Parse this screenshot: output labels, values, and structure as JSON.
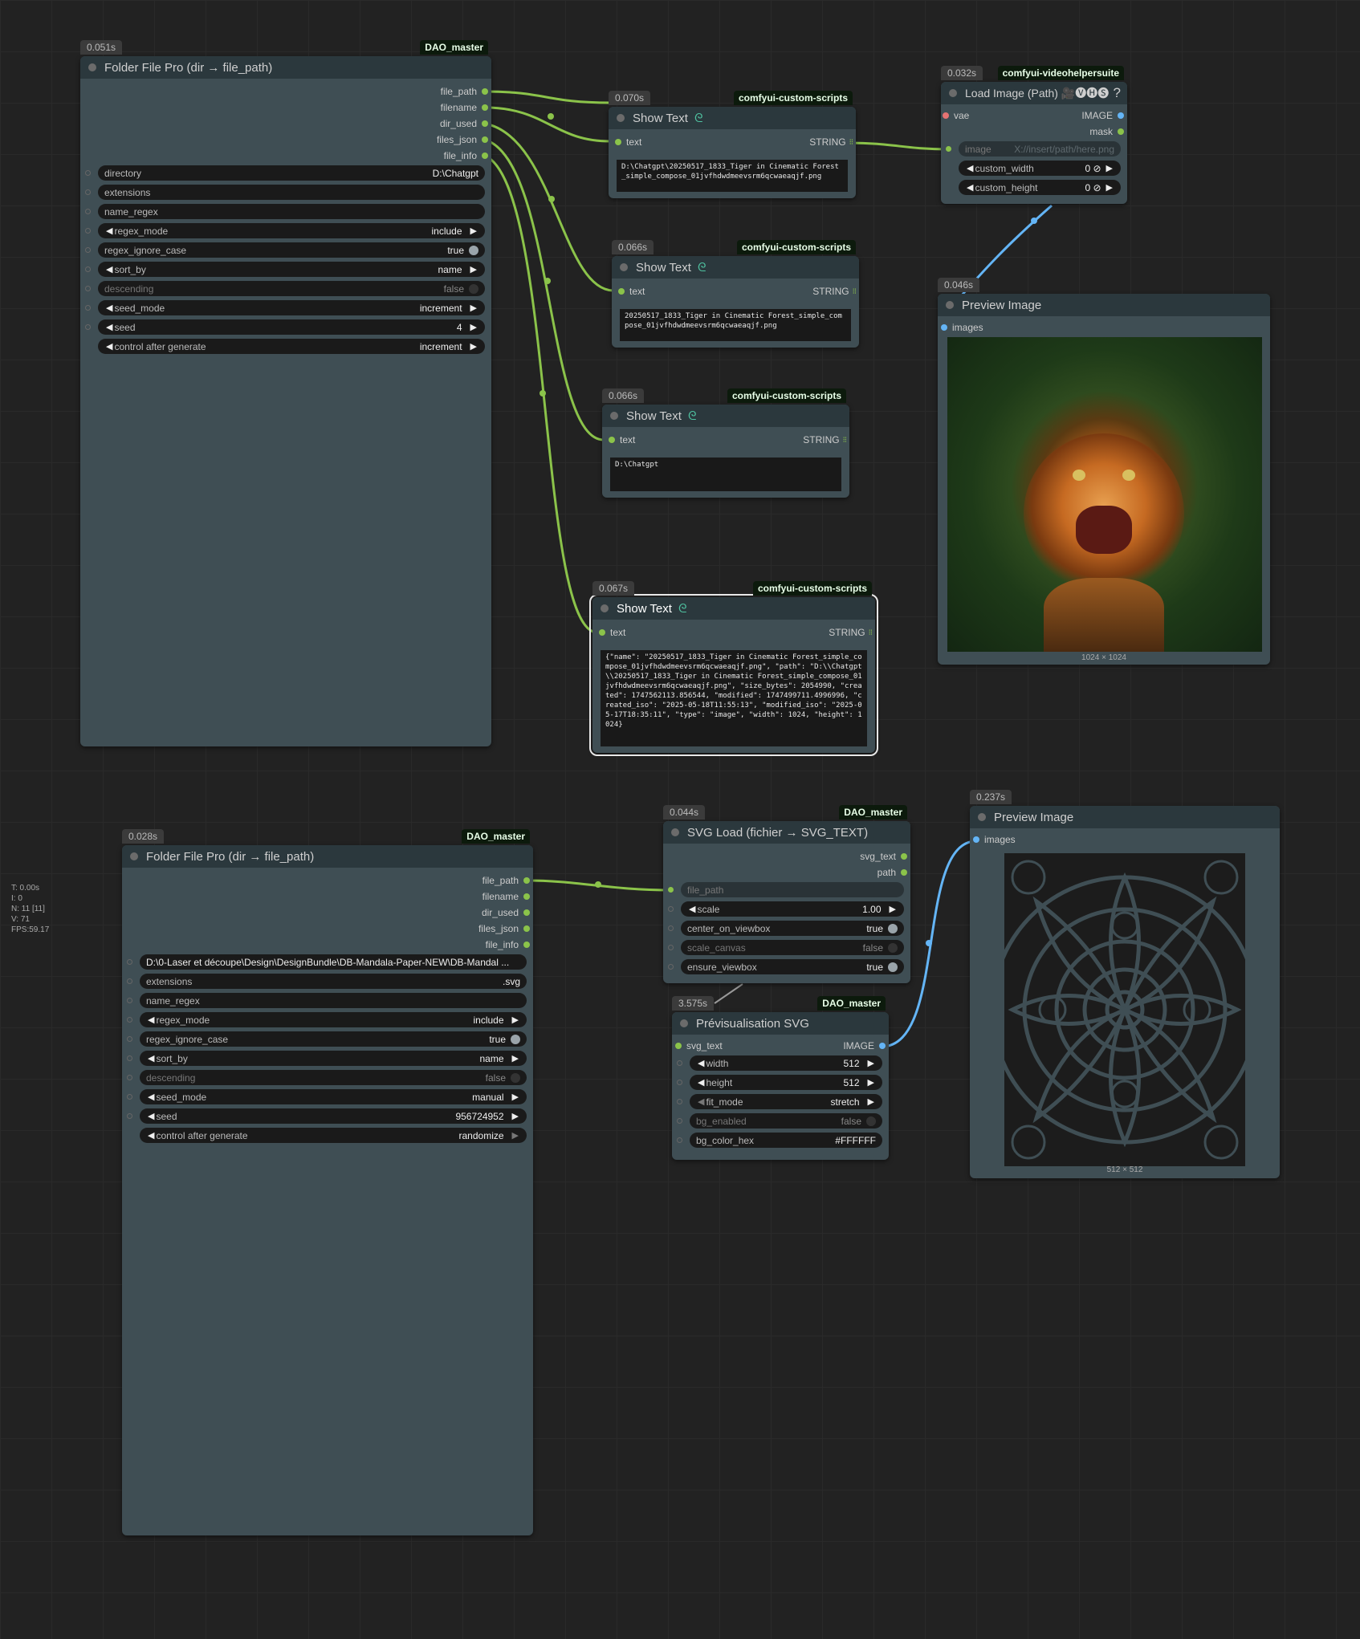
{
  "stats": [
    "T: 0.00s",
    "I: 0",
    "N: 11 [11]",
    "V: 71",
    "FPS:59.17"
  ],
  "folder1": {
    "timing": "0.051s",
    "source": "DAO_master",
    "title": "Folder File Pro (dir → file_path)",
    "outputs": [
      "file_path",
      "filename",
      "dir_used",
      "files_json",
      "file_info"
    ],
    "widgets": [
      {
        "label": "directory",
        "value": "D:\\Chatgpt"
      },
      {
        "label": "extensions",
        "value": ""
      },
      {
        "label": "name_regex",
        "value": ""
      },
      {
        "label": "regex_mode",
        "value": "include"
      },
      {
        "label": "regex_ignore_case",
        "value": "true"
      },
      {
        "label": "sort_by",
        "value": "name"
      },
      {
        "label": "descending",
        "value": "false"
      },
      {
        "label": "seed_mode",
        "value": "increment"
      },
      {
        "label": "seed",
        "value": "4"
      },
      {
        "label": "control after generate",
        "value": "increment"
      }
    ]
  },
  "show1": {
    "timing": "0.070s",
    "source": "comfyui-custom-scripts",
    "title": "Show Text",
    "in": "text",
    "out": "STRING",
    "text": "D:\\Chatgpt\\20250517_1833_Tiger in Cinematic Forest_simple_compose_01jvfhdwdmeevsrm6qcwaeaqjf.png"
  },
  "show2": {
    "timing": "0.066s",
    "source": "comfyui-custom-scripts",
    "title": "Show Text",
    "in": "text",
    "out": "STRING",
    "text": "20250517_1833_Tiger in Cinematic Forest_simple_compose_01jvfhdwdmeevsrm6qcwaeaqjf.png"
  },
  "show3": {
    "timing": "0.066s",
    "source": "comfyui-custom-scripts",
    "title": "Show Text",
    "in": "text",
    "out": "STRING",
    "text": "D:\\Chatgpt"
  },
  "show4": {
    "timing": "0.067s",
    "source": "comfyui-custom-scripts",
    "title": "Show Text",
    "in": "text",
    "out": "STRING",
    "text": "{\"name\": \"20250517_1833_Tiger in Cinematic Forest_simple_compose_01jvfhdwdmeevsrm6qcwaeaqjf.png\", \"path\": \"D:\\\\Chatgpt\\\\20250517_1833_Tiger in Cinematic Forest_simple_compose_01jvfhdwdmeevsrm6qcwaeaqjf.png\", \"size_bytes\": 2054990, \"created\": 1747562113.856544, \"modified\": 1747499711.4996996, \"created_iso\": \"2025-05-18T11:55:13\", \"modified_iso\": \"2025-05-17T18:35:11\", \"type\": \"image\", \"width\": 1024, \"height\": 1024}"
  },
  "loadimg": {
    "timing": "0.032s",
    "source": "comfyui-videohelpersuite",
    "title": "Load Image (Path) 🎥🅥🅗🅢",
    "help": "?",
    "in": "vae",
    "outs": [
      "IMAGE",
      "mask"
    ],
    "image_label": "image",
    "image_placeholder": "X://insert/path/here.png",
    "widgets": [
      {
        "label": "custom_width",
        "value": "0 ⊘"
      },
      {
        "label": "custom_height",
        "value": "0 ⊘"
      }
    ]
  },
  "preview1": {
    "timing": "0.046s",
    "title": "Preview Image",
    "in": "images",
    "caption": "1024 × 1024"
  },
  "folder2": {
    "timing": "0.028s",
    "source": "DAO_master",
    "title": "Folder File Pro (dir → file_path)",
    "outputs": [
      "file_path",
      "filename",
      "dir_used",
      "files_json",
      "file_info"
    ],
    "widgets": [
      {
        "label": "",
        "value": "D:\\0-Laser et découpe\\Design\\DesignBundle\\DB-Mandala-Paper-NEW\\DB-Mandal ..."
      },
      {
        "label": "extensions",
        "value": ".svg"
      },
      {
        "label": "name_regex",
        "value": ""
      },
      {
        "label": "regex_mode",
        "value": "include"
      },
      {
        "label": "regex_ignore_case",
        "value": "true"
      },
      {
        "label": "sort_by",
        "value": "name"
      },
      {
        "label": "descending",
        "value": "false"
      },
      {
        "label": "seed_mode",
        "value": "manual"
      },
      {
        "label": "seed",
        "value": "956724952"
      },
      {
        "label": "control after generate",
        "value": "randomize"
      }
    ]
  },
  "svgload": {
    "timing": "0.044s",
    "source": "DAO_master",
    "title": "SVG Load (fichier → SVG_TEXT)",
    "outs": [
      "svg_text",
      "path"
    ],
    "widgets": [
      {
        "label": "file_path",
        "value": ""
      },
      {
        "label": "scale",
        "value": "1.00"
      },
      {
        "label": "center_on_viewbox",
        "value": "true"
      },
      {
        "label": "scale_canvas",
        "value": "false"
      },
      {
        "label": "ensure_viewbox",
        "value": "true"
      }
    ]
  },
  "svgprev": {
    "timing": "3.575s",
    "source": "DAO_master",
    "title": "Prévisualisation SVG",
    "in": "svg_text",
    "out": "IMAGE",
    "widgets": [
      {
        "label": "width",
        "value": "512"
      },
      {
        "label": "height",
        "value": "512"
      },
      {
        "label": "fit_mode",
        "value": "stretch"
      },
      {
        "label": "bg_enabled",
        "value": "false"
      },
      {
        "label": "bg_color_hex",
        "value": "#FFFFFF"
      }
    ]
  },
  "preview2": {
    "timing": "0.237s",
    "title": "Preview Image",
    "in": "images",
    "caption": "512 × 512"
  },
  "colors": {
    "link_string": "#8bc34a",
    "link_image": "#64b5f6",
    "node_bg": "#3f4e54",
    "canvas": "#222222"
  }
}
